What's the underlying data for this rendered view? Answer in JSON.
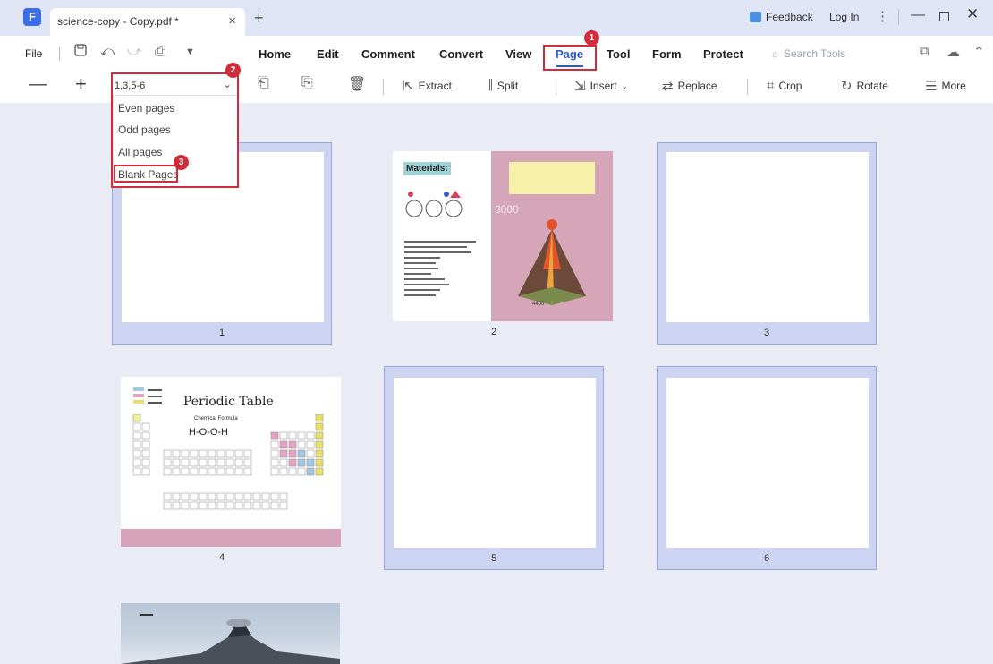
{
  "titlebar": {
    "tab_title": "science-copy - Copy.pdf *",
    "tab_close": "×",
    "new_tab": "+",
    "feedback": "Feedback",
    "login": "Log In",
    "kebab": "⋮",
    "minimize": "—",
    "close": "✕"
  },
  "menubar": {
    "file": "File",
    "items": [
      "Home",
      "Edit",
      "Comment",
      "Convert",
      "View",
      "Page",
      "Tool",
      "Form",
      "Protect"
    ],
    "active": "Page",
    "search_placeholder": "Search Tools"
  },
  "toolbar": {
    "zoom_out": "—",
    "zoom_in": "+",
    "page_range_value": "1,3,5-6",
    "extract": "Extract",
    "split": "Split",
    "insert": "Insert",
    "replace": "Replace",
    "crop": "Crop",
    "rotate": "Rotate",
    "more": "More"
  },
  "dropdown": {
    "options": [
      "Even pages",
      "Odd pages",
      "All pages",
      "Blank Pages"
    ]
  },
  "annotations": {
    "badge_1": "1",
    "badge_2": "2",
    "badge_3": "3",
    "highlight_color": "#d22b3a"
  },
  "pages": [
    {
      "number": "1",
      "selected": true
    },
    {
      "number": "2",
      "selected": false
    },
    {
      "number": "3",
      "selected": true
    },
    {
      "number": "4",
      "selected": false
    },
    {
      "number": "5",
      "selected": true
    },
    {
      "number": "6",
      "selected": true
    }
  ],
  "page2": {
    "title": "Materials:",
    "big_text": "3000",
    "temp": "4400°"
  },
  "page4": {
    "title": "Periodic Table",
    "subtitle": "Chemical Formula",
    "formula": "H-O-O-H"
  },
  "colors": {
    "accent": "#2b59d6",
    "selection": "#cdd4f2",
    "canvas": "#e9ecf5"
  }
}
